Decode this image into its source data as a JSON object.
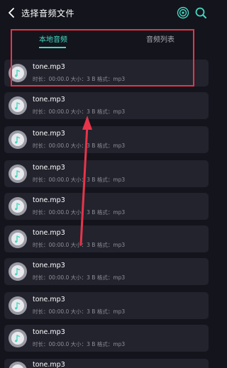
{
  "header": {
    "title": "选择音频文件",
    "icons": [
      "back-icon",
      "spiral-icon",
      "search-icon"
    ]
  },
  "tabs": [
    {
      "label": "本地音频",
      "active": true
    },
    {
      "label": "音频列表",
      "active": false
    }
  ],
  "files": [
    {
      "name": "tone.mp3",
      "meta": "时长：00:00.0    大小：3 B    格式：mp3"
    },
    {
      "name": "tone.mp3",
      "meta": "时长：00:00.0    大小：3 B    格式：mp3"
    },
    {
      "name": "tone.mp3",
      "meta": "时长：00:00.0    大小：3 B    格式：mp3"
    },
    {
      "name": "tone.mp3",
      "meta": "时长：00:00.0    大小：3 B    格式：mp3"
    },
    {
      "name": "tone.mp3",
      "meta": "时长：00:00.0    大小：3 B    格式：mp3"
    },
    {
      "name": "tone.mp3",
      "meta": "时长：00:00.0    大小：3 B    格式：mp3"
    },
    {
      "name": "tone.mp3",
      "meta": "时长：00:00.0    大小：3 B    格式：mp3"
    },
    {
      "name": "tone.mp3",
      "meta": "时长：00:00.0    大小：3 B    格式：mp3"
    },
    {
      "name": "tone.mp3",
      "meta": "时长：00:00.0    大小：3 B    格式：mp3"
    },
    {
      "name": "tone.mp3",
      "meta": ""
    }
  ],
  "colors": {
    "background": "#13141c",
    "row": "#22232d",
    "accent": "#44d9c2",
    "annotation": "#e8344a"
  }
}
